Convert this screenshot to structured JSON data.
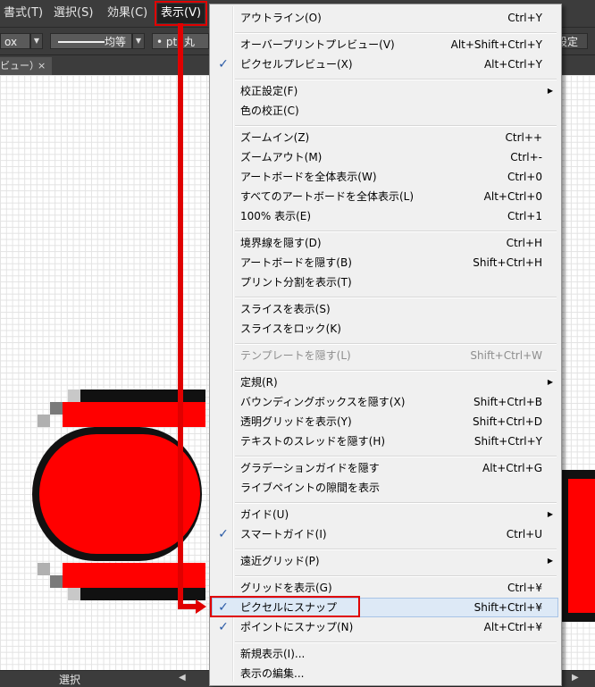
{
  "menubar": {
    "items": [
      {
        "label": "書式(T)"
      },
      {
        "label": "選択(S)"
      },
      {
        "label": "効果(C)"
      },
      {
        "label": "表示(V)"
      }
    ]
  },
  "controlbar": {
    "box_label": "ox",
    "stroke_label": "均等",
    "point_label": "pt. 丸",
    "right_label": "設定"
  },
  "tab": {
    "label": "ビュー）",
    "close": "×"
  },
  "status": {
    "tool": "選択"
  },
  "dropdown": {
    "items": [
      {
        "label": "アウトライン(O)",
        "shortcut": "Ctrl+Y"
      },
      {
        "label": "オーバープリントプレビュー(V)",
        "shortcut": "Alt+Shift+Ctrl+Y"
      },
      {
        "label": "ピクセルプレビュー(X)",
        "shortcut": "Alt+Ctrl+Y",
        "checked": true
      },
      {
        "label": "校正設定(F)",
        "shortcut": "",
        "submenu": true
      },
      {
        "label": "色の校正(C)",
        "shortcut": ""
      },
      {
        "label": "ズームイン(Z)",
        "shortcut": "Ctrl++"
      },
      {
        "label": "ズームアウト(M)",
        "shortcut": "Ctrl+-"
      },
      {
        "label": "アートボードを全体表示(W)",
        "shortcut": "Ctrl+0"
      },
      {
        "label": "すべてのアートボードを全体表示(L)",
        "shortcut": "Alt+Ctrl+0"
      },
      {
        "label": "100% 表示(E)",
        "shortcut": "Ctrl+1"
      },
      {
        "label": "境界線を隠す(D)",
        "shortcut": "Ctrl+H"
      },
      {
        "label": "アートボードを隠す(B)",
        "shortcut": "Shift+Ctrl+H"
      },
      {
        "label": "プリント分割を表示(T)",
        "shortcut": ""
      },
      {
        "label": "スライスを表示(S)",
        "shortcut": ""
      },
      {
        "label": "スライスをロック(K)",
        "shortcut": ""
      },
      {
        "label": "テンプレートを隠す(L)",
        "shortcut": "Shift+Ctrl+W",
        "disabled": true
      },
      {
        "label": "定規(R)",
        "shortcut": "",
        "submenu": true
      },
      {
        "label": "バウンディングボックスを隠す(X)",
        "shortcut": "Shift+Ctrl+B"
      },
      {
        "label": "透明グリッドを表示(Y)",
        "shortcut": "Shift+Ctrl+D"
      },
      {
        "label": "テキストのスレッドを隠す(H)",
        "shortcut": "Shift+Ctrl+Y"
      },
      {
        "label": "グラデーションガイドを隠す",
        "shortcut": "Alt+Ctrl+G"
      },
      {
        "label": "ライブペイントの隙間を表示",
        "shortcut": ""
      },
      {
        "label": "ガイド(U)",
        "shortcut": "",
        "submenu": true
      },
      {
        "label": "スマートガイド(I)",
        "shortcut": "Ctrl+U",
        "checked": true
      },
      {
        "label": "遠近グリッド(P)",
        "shortcut": "",
        "submenu": true
      },
      {
        "label": "グリッドを表示(G)",
        "shortcut": "Ctrl+¥"
      },
      {
        "label": "ピクセルにスナップ",
        "shortcut": "Shift+Ctrl+¥",
        "checked": true,
        "highlighted": true
      },
      {
        "label": "ポイントにスナップ(N)",
        "shortcut": "Alt+Ctrl+¥",
        "checked": true
      },
      {
        "label": "新規表示(I)...",
        "shortcut": ""
      },
      {
        "label": "表示の編集...",
        "shortcut": ""
      }
    ]
  },
  "colors": {
    "shape_fill": "#ff0000",
    "shape_edge": "#000000",
    "annotation": "#e00000",
    "check": "#2a5aa6"
  }
}
